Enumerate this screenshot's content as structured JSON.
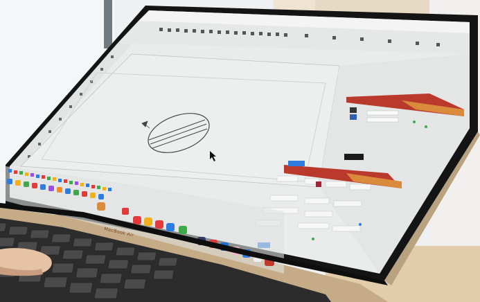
{
  "laptop": {
    "bezel_wordmark": "MacBook Air"
  },
  "app": {
    "panels": [
      {
        "name": "top-panel",
        "accent": "#c0392b"
      },
      {
        "name": "middle-panel",
        "accent": "#c0392b"
      }
    ],
    "canvas_drawing": "circle-with-stripes"
  },
  "colors": {
    "screen_bg": "#e9ecea",
    "toolbar_bg": "#eef0ef",
    "panel_header_red": "#b93a2c",
    "panel_header_orange": "#d98a3a",
    "dock_blue": "#2f7cdf",
    "laptop_body": "#c8b08e",
    "bezel": "#141414",
    "keyboard": "#3a3a3a"
  }
}
